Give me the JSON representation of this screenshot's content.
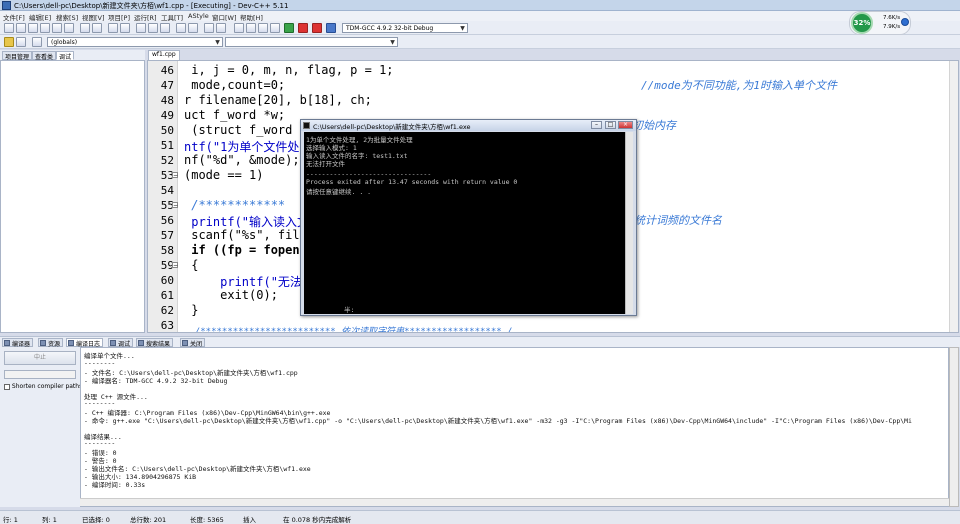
{
  "window": {
    "title": "C:\\Users\\dell-pc\\Desktop\\新建文件夹\\方栢\\wf1.cpp - [Executing] - Dev-C++ 5.11"
  },
  "menu": [
    "文件[F]",
    "编辑[E]",
    "搜索[S]",
    "视图[V]",
    "项目[P]",
    "运行[R]",
    "工具[T]",
    "AStyle",
    "窗口[W]",
    "帮助[H]"
  ],
  "toolbar": {
    "compiler_select": "TDM-GCC 4.9.2 32-bit Debug",
    "scope_select": "(globals)",
    "symbol_select": ""
  },
  "gadget": {
    "cpu": "32%",
    "up": "7.6K/s",
    "down": "7.9K/s"
  },
  "left_tabs": [
    "项目管理",
    "查看类",
    "调试"
  ],
  "file_tab": "wf1.cpp",
  "editor": {
    "line_numbers": [
      "46",
      "47",
      "48",
      "49",
      "50",
      "51",
      "52",
      "53",
      "54",
      "55",
      "56",
      "57",
      "58",
      "59",
      "60",
      "61",
      "62",
      "63",
      "64",
      "65"
    ],
    "lines": [
      " i, j = 0, m, n, flag, p = 1;",
      " mode,count=0;",
      "r filename[20], b[18], ch;",
      "uct f_word *w;",
      " (struct f_word *)",
      "ntf(\"1为单个文件处",
      "nf(\"%d\", &mode);",
      "(mode == 1)",
      "",
      " /************",
      " printf(\"输入读入文",
      " scanf(\"%s\", filena",
      " if ((fp = fopen(fi",
      " {",
      "     printf(\"无法打",
      "     exit(0);",
      " }",
      "",
      "  /************************* 依次读取字符串****************** /",
      ""
    ],
    "right_comments": [
      "//mode为不同功能,为1时输入单个文件",
      "初始内存",
      "统计词频的文件名"
    ]
  },
  "console": {
    "title": "C:\\Users\\dell-pc\\Desktop\\新建文件夹\\方栢\\wf1.exe",
    "lines": [
      "1为单个文件处理, 2为批量文件处理",
      "选择输入模式: 1",
      "输入读入文件的名字: test1.txt",
      "无法打开文件",
      "",
      "--------------------------------",
      "Process exited after 13.47 seconds with return value 0",
      "请按任意键继续. . ."
    ],
    "footer": "半:"
  },
  "bottom_tabs": [
    "编译器",
    "资源",
    "编译日志",
    "调试",
    "搜索结果",
    "关闭"
  ],
  "bottom_left": {
    "abort": "中止",
    "shorten": "Shorten compiler paths"
  },
  "log": [
    "编译单个文件...",
    "--------",
    "- 文件名: C:\\Users\\dell-pc\\Desktop\\新建文件夹\\方栢\\wf1.cpp",
    "- 编译器名: TDM-GCC 4.9.2 32-bit Debug",
    "",
    "处理 C++ 源文件...",
    "--------",
    "- C++ 编译器: C:\\Program Files (x86)\\Dev-Cpp\\MinGW64\\bin\\g++.exe",
    "- 命令: g++.exe \"C:\\Users\\dell-pc\\Desktop\\新建文件夹\\方栢\\wf1.cpp\" -o \"C:\\Users\\dell-pc\\Desktop\\新建文件夹\\方栢\\wf1.exe\" -m32 -g3 -I\"C:\\Program Files (x86)\\Dev-Cpp\\MinGW64\\include\" -I\"C:\\Program Files (x86)\\Dev-Cpp\\Mi",
    "",
    "编译结果...",
    "--------",
    "- 错误: 0",
    "- 警告: 0",
    "- 输出文件名: C:\\Users\\dell-pc\\Desktop\\新建文件夹\\方栢\\wf1.exe",
    "- 输出大小: 134.8904296875 KiB",
    "- 编译时间: 0.33s"
  ],
  "status": {
    "row": "行: 1",
    "col": "列: 1",
    "selected": "已选择: 0",
    "total": "总行数: 201",
    "length": "长度: 5365",
    "mode": "插入",
    "parse": "在 0.078 秒内完成解析"
  }
}
